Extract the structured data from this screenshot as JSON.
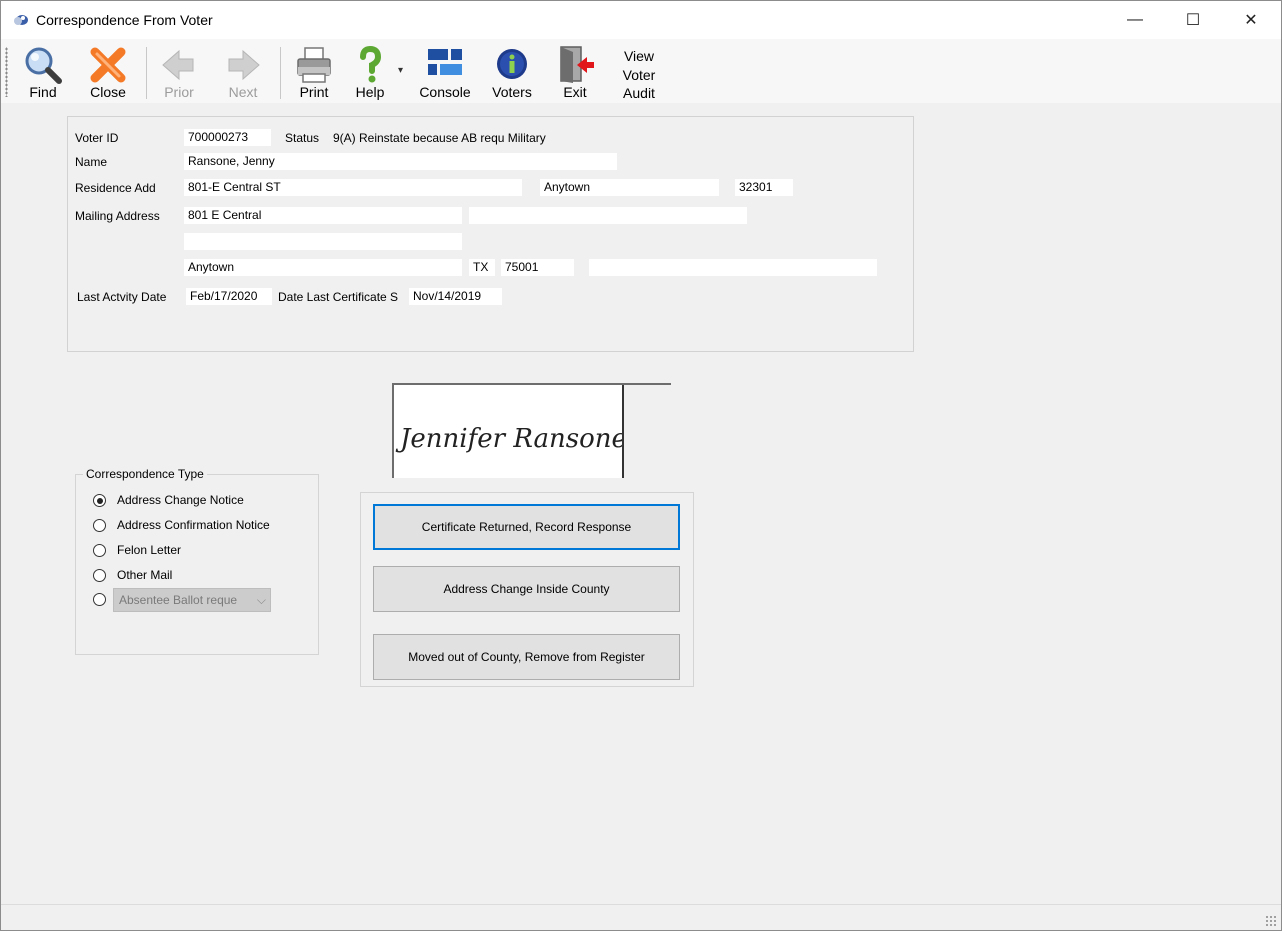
{
  "window": {
    "title": "Correspondence From Voter",
    "minimize_glyph": "—",
    "maximize_glyph": "☐",
    "close_glyph": "✕"
  },
  "toolbar": {
    "find": "Find",
    "close": "Close",
    "prior": "Prior",
    "next": "Next",
    "print": "Print",
    "help": "Help",
    "help_dropdown_glyph": "▾",
    "console": "Console",
    "voters": "Voters",
    "exit": "Exit",
    "view_voter_audit": [
      "View",
      "Voter",
      "Audit"
    ]
  },
  "voter": {
    "voter_id_label": "Voter ID",
    "voter_id": "700000273",
    "status_label": "Status",
    "status": "9(A) Reinstate because AB requ Military",
    "name_label": "Name",
    "name": "Ransone, Jenny",
    "residence_label": "Residence Add",
    "residence_street": "801-E Central ST",
    "residence_city": "Anytown",
    "residence_zip": "32301",
    "mailing_label": "Mailing Address",
    "mailing_line1": "801 E Central",
    "mailing_line1b": "",
    "mailing_line2": "",
    "mailing_city": "Anytown",
    "mailing_state": "TX",
    "mailing_zip": "75001",
    "mailing_country": "",
    "last_activity_label": "Last Actvity Date",
    "last_activity": "Feb/17/2020",
    "last_cert_label": "Date Last Certificate S",
    "last_cert": "Nov/14/2019"
  },
  "signature_text": "Jennifer Ransone",
  "correspondence": {
    "title": "Correspondence Type",
    "options": [
      {
        "label": "Address Change Notice",
        "checked": true
      },
      {
        "label": "Address Confirmation Notice",
        "checked": false
      },
      {
        "label": "Felon Letter",
        "checked": false
      },
      {
        "label": "Other Mail",
        "checked": false
      }
    ],
    "absentee_value": "Absentee Ballot reque",
    "absentee_chevron": "⌵"
  },
  "actions": {
    "certificate_returned": "Certificate Returned, Record Response",
    "address_change": "Address Change Inside County",
    "moved_out": "Moved out of County, Remove from Register"
  },
  "colors": {
    "focus": "#0078d7",
    "close_x": "#f47a28",
    "voters_icon": "#1e3a8a",
    "help_icon": "#5ca832"
  }
}
